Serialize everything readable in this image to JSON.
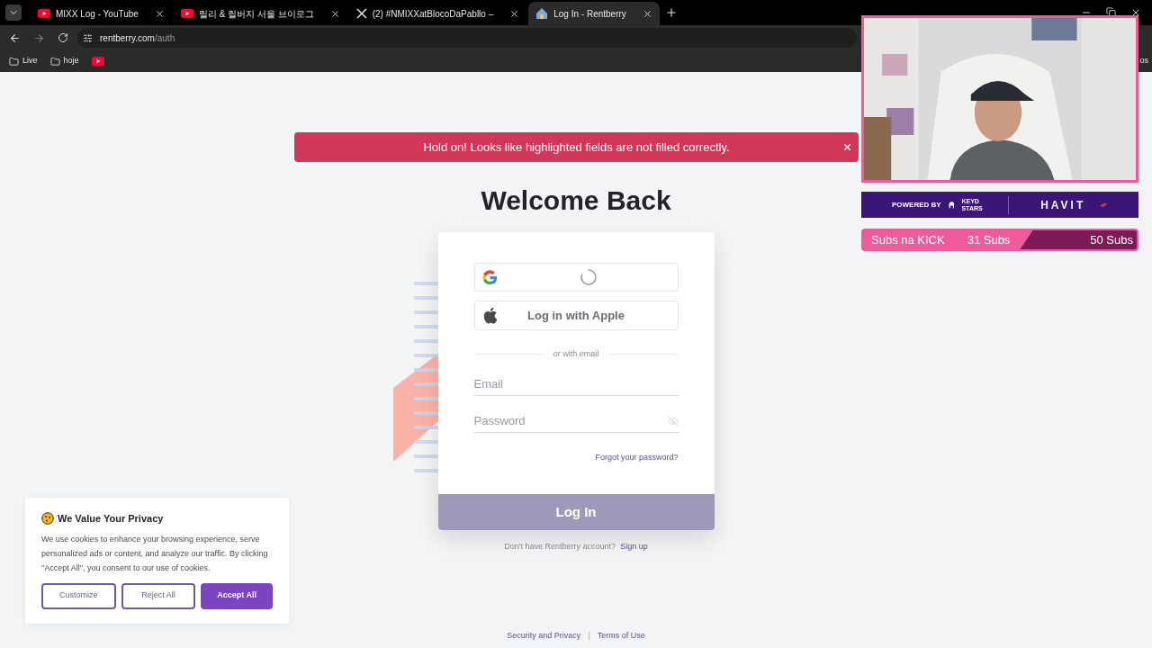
{
  "browser": {
    "tabs": [
      {
        "title": "MIXX Log - YouTube",
        "kind": "youtube",
        "selected": false
      },
      {
        "title": "릴리 & 릴버지 서울 브이로그",
        "kind": "youtube",
        "selected": false
      },
      {
        "title": "(2) #NMIXXatBlocoDaPabllo –",
        "kind": "x",
        "selected": false
      },
      {
        "title": "Log In - Rentberry",
        "kind": "site",
        "selected": true
      }
    ],
    "address": {
      "host": "rentberry.com",
      "path": "/auth"
    },
    "bookmarks": [
      {
        "label": "Live",
        "kind": "folder"
      },
      {
        "label": "hoje",
        "kind": "folder"
      },
      {
        "kind": "youtube"
      }
    ],
    "bookmarks_edge": "os"
  },
  "alert": {
    "message": "Hold on! Looks like highlighted fields are not filled correctly."
  },
  "heading": "Welcome Back",
  "login": {
    "google": {
      "loading": true
    },
    "apple": "Log in with Apple",
    "divider": "or with email",
    "email": {
      "placeholder": "Email"
    },
    "password": {
      "placeholder": "Password"
    },
    "forgot": "Forgot your password?",
    "submit": {
      "label": "Log In",
      "disabled": true
    },
    "signup_prompt": "Don't have Rentberry account?",
    "signup_link": "Sign up"
  },
  "cookie": {
    "title": "We Value Your Privacy",
    "body": "We use cookies to enhance your browsing experience, serve personalized ads or content, and analyze our traffic. By clicking \"Accept All\", you consent to our use of cookies.",
    "buttons": [
      {
        "label": "Customize",
        "kind": "outline"
      },
      {
        "label": "Reject All",
        "kind": "outline"
      },
      {
        "label": "Accept All",
        "kind": "filled"
      }
    ]
  },
  "footer": {
    "links": [
      "Security and Privacy",
      "Terms of Use"
    ],
    "separator": "|"
  },
  "overlay": {
    "banner": {
      "powered_by": "POWERED BY",
      "logo_lines": [
        "KEYD",
        "STARS"
      ],
      "brand": "HAVIT"
    },
    "goal": {
      "label": "Subs na KICK",
      "current": "31 Subs",
      "target": "50 Subs",
      "level": 0.62
    }
  }
}
